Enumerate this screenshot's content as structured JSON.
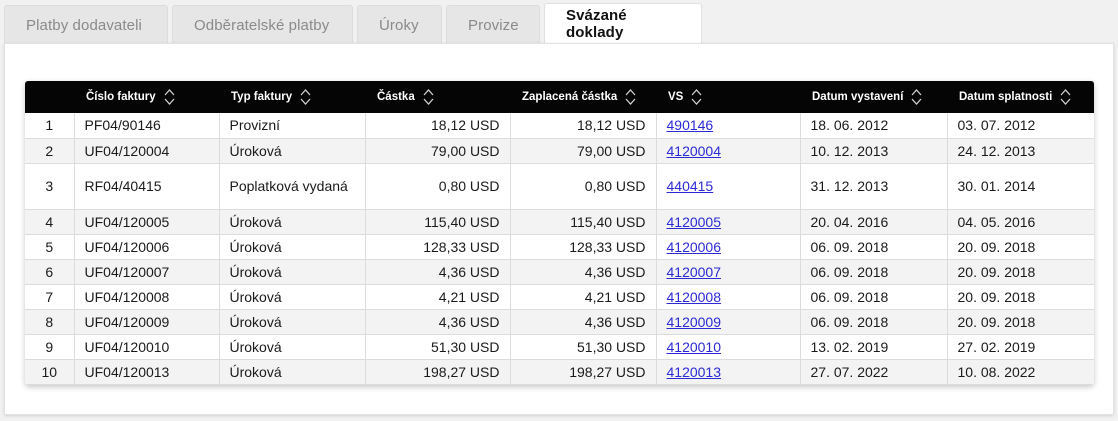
{
  "tabs": [
    {
      "label": "Platby dodavateli",
      "active": false
    },
    {
      "label": "Odběratelské platby",
      "active": false
    },
    {
      "label": "Úroky",
      "active": false
    },
    {
      "label": "Provize",
      "active": false
    },
    {
      "label": "Svázané doklady",
      "active": true
    }
  ],
  "table": {
    "headers": [
      "",
      "Číslo faktury",
      "Typ faktury",
      "Částka",
      "Zaplacená částka",
      "VS",
      "Datum vystavení",
      "Datum splatnosti"
    ],
    "rows": [
      {
        "idx": "1",
        "invoice": "PF04/90146",
        "type": "Provizní",
        "amount": "18,12 USD",
        "paid": "18,12 USD",
        "vs": "490146",
        "issued": "18. 06. 2012",
        "due": "03. 07. 2012"
      },
      {
        "idx": "2",
        "invoice": "UF04/120004",
        "type": "Úroková",
        "amount": "79,00 USD",
        "paid": "79,00 USD",
        "vs": "4120004",
        "issued": "10. 12. 2013",
        "due": "24. 12. 2013"
      },
      {
        "idx": "3",
        "invoice": "RF04/40415",
        "type": "Poplatková vydaná",
        "amount": "0,80 USD",
        "paid": "0,80 USD",
        "vs": "440415",
        "issued": "31. 12. 2013",
        "due": "30. 01. 2014"
      },
      {
        "idx": "4",
        "invoice": "UF04/120005",
        "type": "Úroková",
        "amount": "115,40 USD",
        "paid": "115,40 USD",
        "vs": "4120005",
        "issued": "20. 04. 2016",
        "due": "04. 05. 2016"
      },
      {
        "idx": "5",
        "invoice": "UF04/120006",
        "type": "Úroková",
        "amount": "128,33 USD",
        "paid": "128,33 USD",
        "vs": "4120006",
        "issued": "06. 09. 2018",
        "due": "20. 09. 2018"
      },
      {
        "idx": "6",
        "invoice": "UF04/120007",
        "type": "Úroková",
        "amount": "4,36 USD",
        "paid": "4,36 USD",
        "vs": "4120007",
        "issued": "06. 09. 2018",
        "due": "20. 09. 2018"
      },
      {
        "idx": "7",
        "invoice": "UF04/120008",
        "type": "Úroková",
        "amount": "4,21 USD",
        "paid": "4,21 USD",
        "vs": "4120008",
        "issued": "06. 09. 2018",
        "due": "20. 09. 2018"
      },
      {
        "idx": "8",
        "invoice": "UF04/120009",
        "type": "Úroková",
        "amount": "4,36 USD",
        "paid": "4,36 USD",
        "vs": "4120009",
        "issued": "06. 09. 2018",
        "due": "20. 09. 2018"
      },
      {
        "idx": "9",
        "invoice": "UF04/120010",
        "type": "Úroková",
        "amount": "51,30 USD",
        "paid": "51,30 USD",
        "vs": "4120010",
        "issued": "13. 02. 2019",
        "due": "27. 02. 2019"
      },
      {
        "idx": "10",
        "invoice": "UF04/120013",
        "type": "Úroková",
        "amount": "198,27 USD",
        "paid": "198,27 USD",
        "vs": "4120013",
        "issued": "27. 07. 2022",
        "due": "10. 08. 2022"
      }
    ]
  },
  "colors": {
    "header_bg": "#050505",
    "link": "#2b2bd6",
    "stripe": "#f3f3f3"
  }
}
